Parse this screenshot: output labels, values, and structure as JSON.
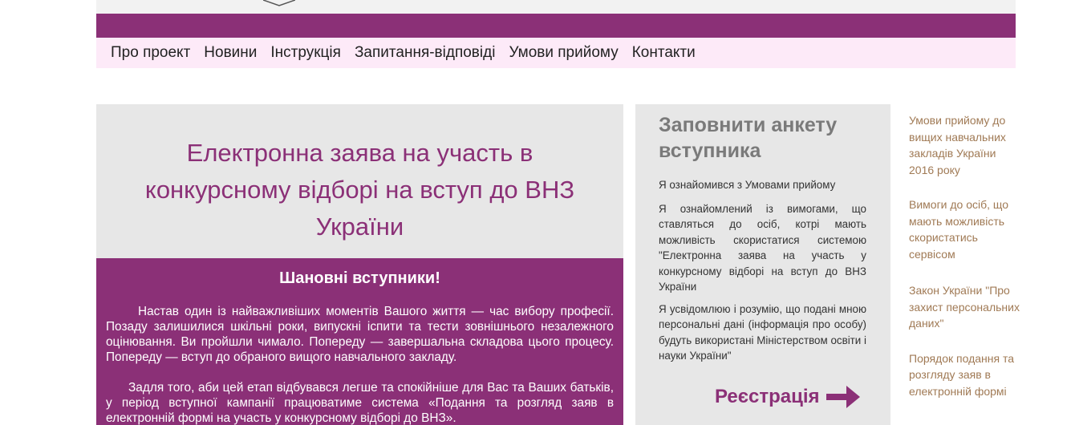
{
  "nav": {
    "items": [
      "Про проект",
      "Новини",
      "Інструкція",
      "Запитання-відповіді",
      "Умови прийому",
      "Контакти"
    ]
  },
  "main": {
    "title": "Електронна заява на участь в конкурсному відборі на вступ до ВНЗ України",
    "greeting": "Шановні вступники!",
    "paragraph1": "Настав один із найважливіших моментів Вашого життя — час вибору професії. Позаду залишилися шкільні роки, випускні іспити та тести зовнішнього незалежного оцінювання. Ви пройшли чимало. Попереду — завершальна складова цього процесу. Попереду — вступ до обраного вищого навчального закладу.",
    "paragraph2": "Задля того, аби цей етап відбувався легше та спокійніше для Вас та Ваших батьків, у період вступної кампанії працюватиме система «Подання та розгляд заяв в електронній формі на участь у конкурсному відборі до ВНЗ»."
  },
  "form": {
    "title": "Заповнити анкету вступника",
    "consent1": "Я ознайомився з Умовами прийому",
    "consent2": "Я ознайомлений із вимогами, що ставляться до осіб, котрі мають можливість скористатися системою \"Електронна заява на участь у конкурсному відборі на вступ до ВНЗ України",
    "consent3": "Я усвідомлюю і розумію, що подані мною персональні дані (інформація про особу) будуть використані Міністерством освіти і науки України\"",
    "register_label": "Реєстрація",
    "accent_color": "#8b3077"
  },
  "sidebar": {
    "links": [
      "Умови прийому до вищих навчальних закладів України 2016 року",
      "Вимоги до осіб, що мають можливість скористатись сервісом",
      "Закон України \"Про захист персональних даних\"",
      "Порядок подання та розгляду заяв в електронній формі"
    ]
  }
}
